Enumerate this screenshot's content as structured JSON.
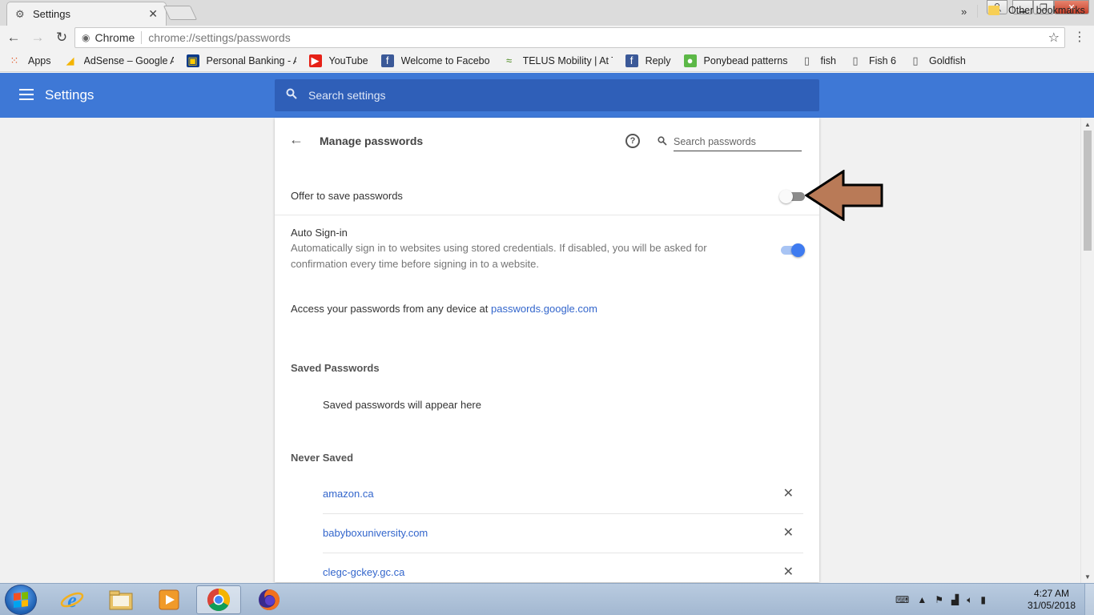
{
  "browser": {
    "tab_title": "Settings",
    "omnibox": {
      "site_name": "Chrome",
      "url": "chrome://settings/passwords"
    },
    "bookmarks": [
      {
        "label": "Apps",
        "icon": "apps-grid-icon"
      },
      {
        "label": "AdSense – Google A",
        "icon": "adsense-icon"
      },
      {
        "label": "Personal Banking - A",
        "icon": "bank-icon"
      },
      {
        "label": "YouTube",
        "icon": "youtube-icon"
      },
      {
        "label": "Welcome to Facebo",
        "icon": "facebook-icon"
      },
      {
        "label": "TELUS Mobility | At T",
        "icon": "telus-icon"
      },
      {
        "label": "Reply",
        "icon": "facebook-icon"
      },
      {
        "label": "Ponybead patterns",
        "icon": "ponybead-icon"
      },
      {
        "label": "fish",
        "icon": "page-icon"
      },
      {
        "label": "Fish 6",
        "icon": "page-icon"
      },
      {
        "label": "Goldfish",
        "icon": "page-icon"
      }
    ],
    "bookmarks_more": "»",
    "other_bookmarks": "Other bookmarks"
  },
  "settings": {
    "header_title": "Settings",
    "search_placeholder": "Search settings",
    "page_title": "Manage passwords",
    "password_search_placeholder": "Search passwords",
    "offer_to_save_label": "Offer to save passwords",
    "offer_to_save_enabled": false,
    "auto_signin_title": "Auto Sign-in",
    "auto_signin_description": "Automatically sign in to websites using stored credentials. If disabled, you will be asked for confirmation every time before signing in to a website.",
    "auto_signin_enabled": true,
    "access_text": "Access your passwords from any device at ",
    "access_link": "passwords.google.com",
    "saved_passwords_heading": "Saved Passwords",
    "saved_passwords_empty": "Saved passwords will appear here",
    "never_saved_heading": "Never Saved",
    "never_saved_sites": [
      "amazon.ca",
      "babyboxuniversity.com",
      "clegc-gckey.gc.ca"
    ]
  },
  "taskbar": {
    "apps": [
      {
        "name": "internet-explorer-icon"
      },
      {
        "name": "file-explorer-icon"
      },
      {
        "name": "media-player-icon"
      },
      {
        "name": "chrome-icon",
        "active": true
      },
      {
        "name": "firefox-icon"
      }
    ],
    "clock_time": "4:27 AM",
    "clock_date": "31/05/2018"
  },
  "colors": {
    "settings_blue": "#3e78d6",
    "link_blue": "#3366cc",
    "toggle_on": "#3e7bf0",
    "annotation_arrow": "#b97a57"
  }
}
